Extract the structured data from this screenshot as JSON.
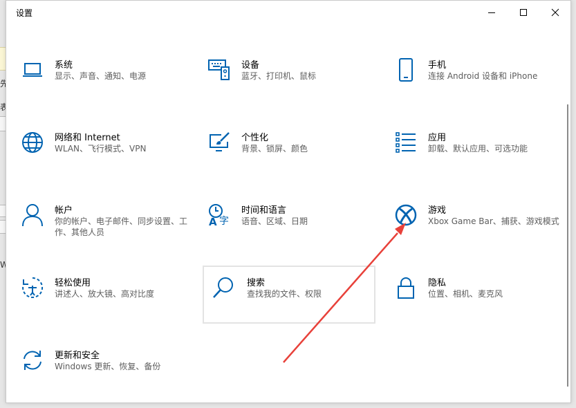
{
  "window": {
    "title": "设置",
    "controls": {
      "minimize_icon": "minimize-icon",
      "maximize_icon": "maximize-icon",
      "close_icon": "close-icon"
    }
  },
  "accent_color": "#0063b1",
  "background_fragments": [
    "先",
    "表",
    "Wi"
  ],
  "categories": [
    {
      "id": "system",
      "name": "系统",
      "desc": "显示、声音、通知、电源",
      "icon": "laptop-icon"
    },
    {
      "id": "devices",
      "name": "设备",
      "desc": "蓝牙、打印机、鼠标",
      "icon": "keyboard-devices-icon"
    },
    {
      "id": "phone",
      "name": "手机",
      "desc": "连接 Android 设备和 iPhone",
      "icon": "phone-icon"
    },
    {
      "id": "network",
      "name": "网络和 Internet",
      "desc": "WLAN、飞行模式、VPN",
      "icon": "globe-icon"
    },
    {
      "id": "personalization",
      "name": "个性化",
      "desc": "背景、锁屏、颜色",
      "icon": "paint-brush-icon"
    },
    {
      "id": "apps",
      "name": "应用",
      "desc": "卸载、默认应用、可选功能",
      "icon": "apps-list-icon"
    },
    {
      "id": "accounts",
      "name": "帐户",
      "desc": "你的帐户、电子邮件、同步设置、工作、其他人员",
      "icon": "person-icon"
    },
    {
      "id": "time-language",
      "name": "时间和语言",
      "desc": "语音、区域、日期",
      "icon": "clock-language-icon"
    },
    {
      "id": "gaming",
      "name": "游戏",
      "desc": "Xbox Game Bar、捕获、游戏模式",
      "icon": "xbox-icon"
    },
    {
      "id": "ease-of-access",
      "name": "轻松使用",
      "desc": "讲述人、放大镜、高对比度",
      "icon": "ease-of-access-icon"
    },
    {
      "id": "search",
      "name": "搜索",
      "desc": "查找我的文件、权限",
      "icon": "search-icon"
    },
    {
      "id": "privacy",
      "name": "隐私",
      "desc": "位置、相机、麦克风",
      "icon": "lock-icon"
    },
    {
      "id": "update-security",
      "name": "更新和安全",
      "desc": "Windows 更新、恢复、备份",
      "icon": "sync-icon"
    }
  ],
  "annotation": {
    "color": "#e8413a",
    "points_to": "gaming"
  }
}
